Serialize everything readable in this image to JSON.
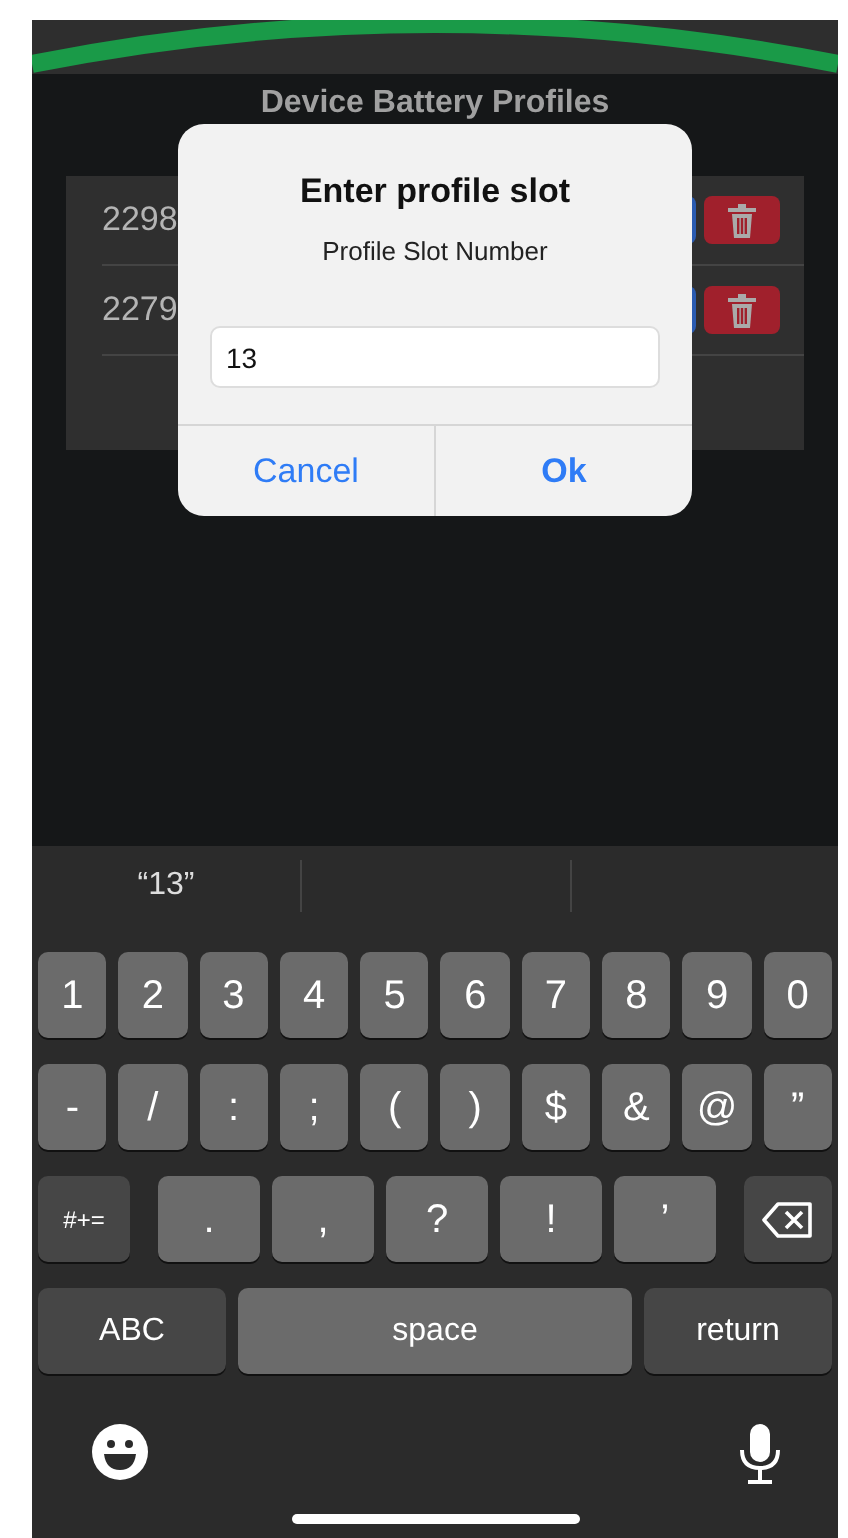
{
  "app": {
    "title": "Device Battery Profiles",
    "profiles": [
      {
        "id": "2298"
      },
      {
        "id": "2279"
      }
    ]
  },
  "dialog": {
    "title": "Enter profile slot",
    "message": "Profile Slot Number",
    "value": "13",
    "buttons": [
      {
        "label": "Cancel",
        "kind": "cancel"
      },
      {
        "label": "Ok",
        "kind": "default"
      }
    ]
  },
  "keyboard": {
    "suggestions": [
      "“13”"
    ],
    "rows": [
      {
        "keys": [
          {
            "label": "1",
            "kind": "char"
          },
          {
            "label": "2",
            "kind": "char"
          },
          {
            "label": "3",
            "kind": "char"
          },
          {
            "label": "4",
            "kind": "char"
          },
          {
            "label": "5",
            "kind": "char"
          },
          {
            "label": "6",
            "kind": "char"
          },
          {
            "label": "7",
            "kind": "char"
          },
          {
            "label": "8",
            "kind": "char"
          },
          {
            "label": "9",
            "kind": "char"
          },
          {
            "label": "0",
            "kind": "char"
          }
        ]
      },
      {
        "keys": [
          {
            "label": "-",
            "kind": "char"
          },
          {
            "label": "/",
            "kind": "char"
          },
          {
            "label": ":",
            "kind": "char"
          },
          {
            "label": ";",
            "kind": "char"
          },
          {
            "label": "(",
            "kind": "char"
          },
          {
            "label": ")",
            "kind": "char"
          },
          {
            "label": "$",
            "kind": "char"
          },
          {
            "label": "&",
            "kind": "char"
          },
          {
            "label": "@",
            "kind": "char"
          },
          {
            "label": "”",
            "kind": "char"
          }
        ]
      },
      {
        "keys": [
          {
            "label": "#+=",
            "kind": "shift"
          },
          {
            "label": ".",
            "kind": "wide"
          },
          {
            "label": ",",
            "kind": "wide"
          },
          {
            "label": "?",
            "kind": "wide"
          },
          {
            "label": "!",
            "kind": "wide"
          },
          {
            "label": "’",
            "kind": "wide"
          },
          {
            "kind": "backspace"
          }
        ]
      },
      {
        "keys": [
          {
            "label": "ABC",
            "kind": "mode"
          },
          {
            "label": "space",
            "kind": "space"
          },
          {
            "label": "return",
            "kind": "return"
          }
        ]
      }
    ]
  }
}
